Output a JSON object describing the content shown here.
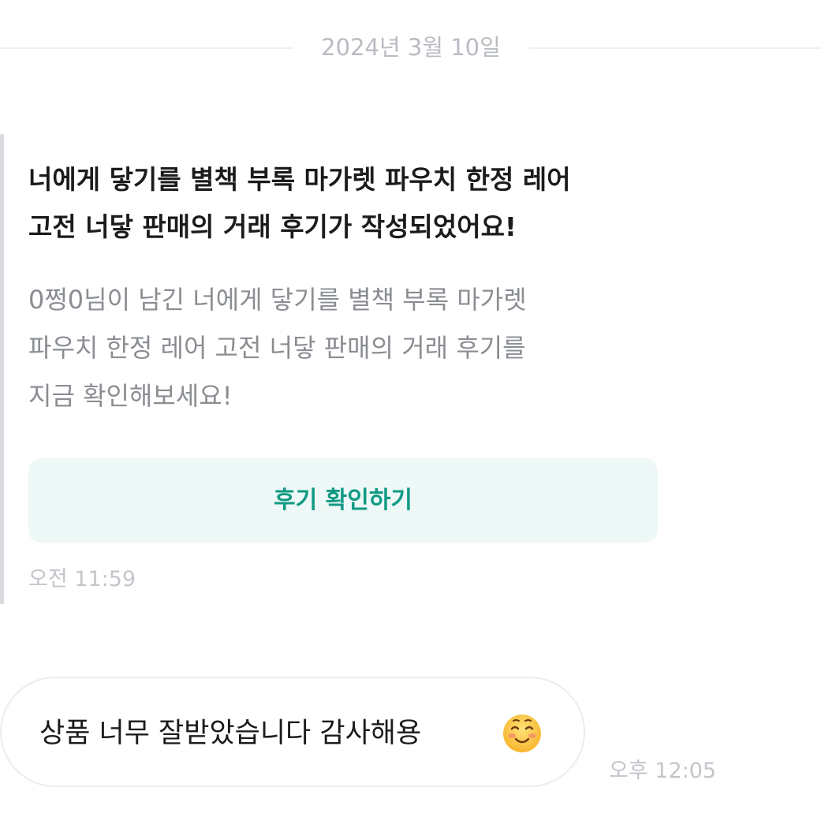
{
  "date_separator": "2024년 3월 10일",
  "notice": {
    "title": "너에게 닿기를 별책 부록 마가렛 파우치 한정 레어\n 고전 너닿 판매의 거래 후기가 작성되었어요!",
    "body": "0쩡0님이 남긴 너에게 닿기를 별책 부록 마가렛\n파우치 한정 레어 고전 너닿 판매의 거래 후기를\n지금 확인해보세요!",
    "button_label": "후기 확인하기",
    "time": "오전 11:59"
  },
  "message": {
    "text": "상품 너무 잘받았습니다 감사해용",
    "emoji_icon": "smiling-face-icon",
    "time": "오후 12:05"
  },
  "colors": {
    "button_bg": "#eef8f6",
    "button_text": "#119a84",
    "muted_text": "#8a8d92",
    "timestamp": "#c3c5ca"
  }
}
